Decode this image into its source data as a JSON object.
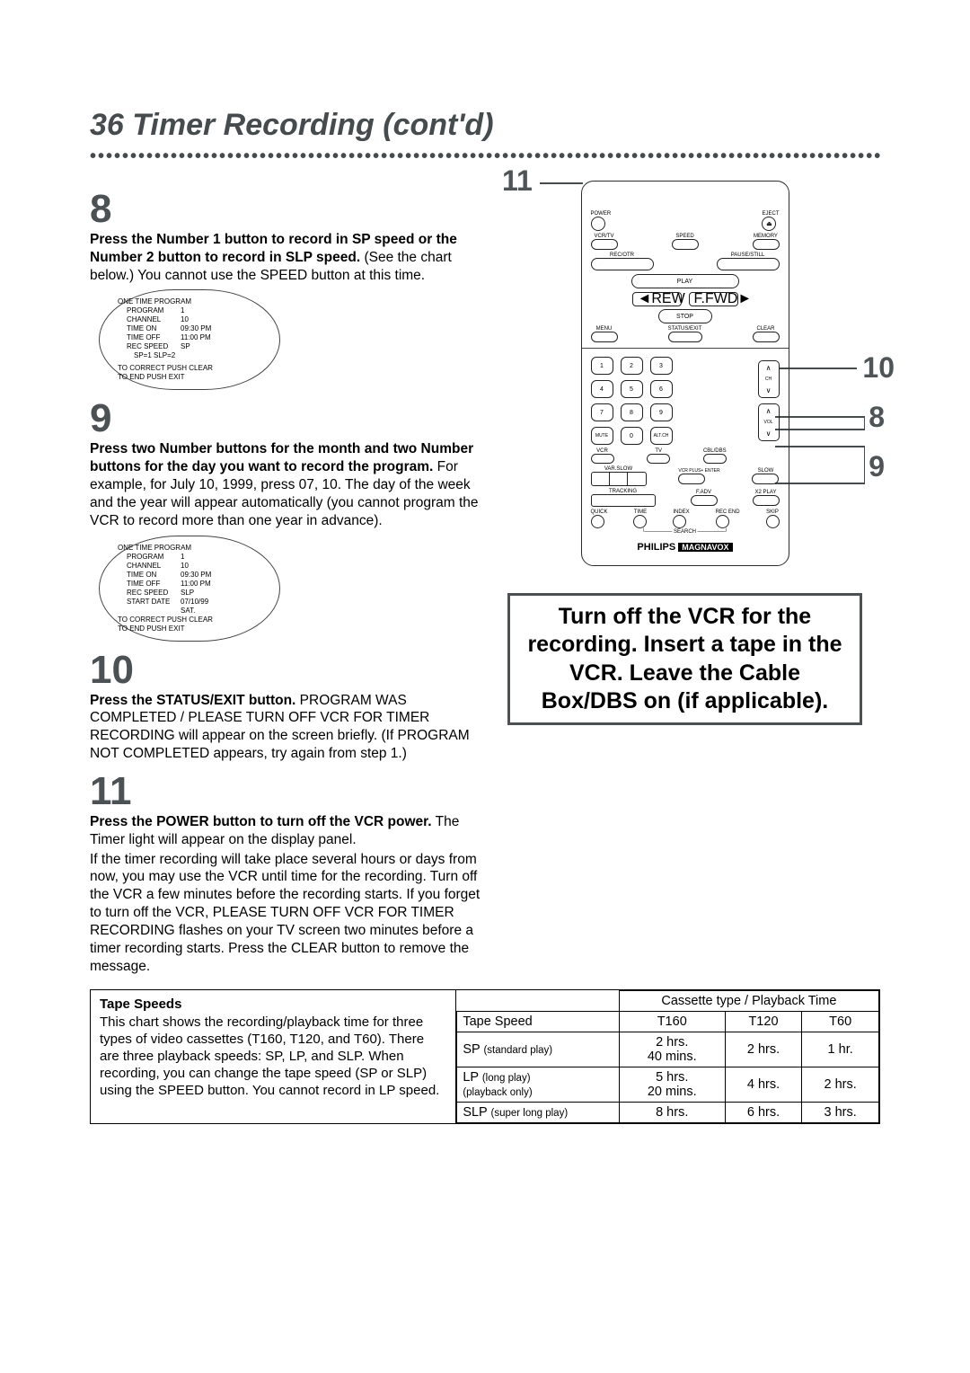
{
  "title": "36  Timer Recording (cont'd)",
  "steps": {
    "s8": {
      "num": "8",
      "bold": "Press the Number 1 button to record in SP speed or the Number 2 button to record in SLP speed.",
      "rest": " (See the chart below.) You cannot use the SPEED button at this time."
    },
    "s9": {
      "num": "9",
      "bold": "Press two Number buttons for the month and two Number buttons for the day you want to record the program.",
      "rest": " For example, for July 10, 1999, press 07, 10. The day of the week and the year will appear automatically (you cannot program the VCR to record more than one year in advance)."
    },
    "s10": {
      "num": "10",
      "bold": "Press the STATUS/EXIT button.",
      "rest": " PROGRAM WAS COMPLETED / PLEASE TURN OFF VCR FOR TIMER RECORDING will appear on the screen briefly. (If PROGRAM NOT COMPLETED appears, try again from step 1.)"
    },
    "s11": {
      "num": "11",
      "bold": "Press the POWER button to turn off the VCR power.",
      "rest": " The Timer light will appear on the display panel.",
      "para2": "If the timer recording will take place several hours or days from now, you may use the VCR until time for the recording. Turn off the VCR a few minutes before the recording starts. If you forget to turn off the VCR, PLEASE TURN OFF VCR FOR TIMER RECORDING flashes on your TV screen two minutes before a timer recording starts. Press the CLEAR button to remove the message."
    }
  },
  "osd1": {
    "title": "ONE TIME PROGRAM",
    "program": "1",
    "channel": "10",
    "timeon": "09:30 PM",
    "timeoff": "11:00 PM",
    "rec": "SP",
    "opts": "SP=1    SLP=2",
    "f1": "TO CORRECT PUSH CLEAR",
    "f2": "TO END PUSH EXIT"
  },
  "osd2": {
    "title": "ONE TIME PROGRAM",
    "program": "1",
    "channel": "10",
    "timeon": "09:30 PM",
    "timeoff": "11:00 PM",
    "rec": "SLP",
    "date": "07/10/99",
    "day": "SAT.",
    "f1": "TO CORRECT PUSH CLEAR",
    "f2": "TO END PUSH EXIT"
  },
  "osd_labels": {
    "program": "PROGRAM",
    "channel": "CHANNEL",
    "timeon": "TIME ON",
    "timeoff": "TIME OFF",
    "rec": "REC SPEED",
    "date": "START DATE"
  },
  "remote": {
    "power": "POWER",
    "eject": "EJECT",
    "vcrtv": "VCR/TV",
    "speed": "SPEED",
    "memory": "MEMORY",
    "recotr": "REC/OTR",
    "pause": "PAUSE/STILL",
    "play": "PLAY",
    "rew": "REW",
    "ffwd": "F.FWD",
    "stop": "STOP",
    "menu": "MENU",
    "status": "STATUS/EXIT",
    "clear": "CLEAR",
    "mute": "MUTE",
    "altch": "ALT.CH",
    "ch": "CH",
    "vol": "VOL",
    "vcr": "VCR",
    "tv": "TV",
    "cbl": "CBL/DBS",
    "varslow": "VAR.SLOW",
    "enter": "VCR PLUS+ ENTER",
    "slow": "SLOW",
    "tracking": "TRACKING",
    "fadv": "F.ADV",
    "x2": "X2 PLAY",
    "quick": "QUICK",
    "time": "TIME",
    "index": "INDEX",
    "recend": "REC END",
    "skip": "SKIP",
    "search": "SEARCH",
    "brand": "PHILIPS",
    "brand2": "MAGNAVOX"
  },
  "callouts": {
    "c11": "11",
    "c10": "10",
    "c8": "8",
    "c9": "9"
  },
  "sidebox": "Turn off the VCR for the recording. Insert a tape in the VCR. Leave the Cable Box/DBS on (if applicable).",
  "tape": {
    "heading": "Tape Speeds",
    "text": "This chart shows the recording/playback time for three types of video cassettes (T160, T120, and T60). There are three playback speeds: SP, LP, and SLP. When recording, you can change the tape speed (SP or SLP) using the SPEED button. You cannot record in LP speed.",
    "colhead": "Cassette type / Playback Time",
    "tsh": "Tape Speed",
    "t160": "T160",
    "t120": "T120",
    "t60": "T60",
    "sp": "SP",
    "sp_sub": "(standard play)",
    "sp160a": "2 hrs.",
    "sp160b": "40 mins.",
    "sp120": "2 hrs.",
    "sp60": "1 hr.",
    "lp": "LP",
    "lp_sub": "(long play)",
    "lp_sub2": "(playback only)",
    "lp160a": "5 hrs.",
    "lp160b": "20 mins.",
    "lp120": "4 hrs.",
    "lp60": "2 hrs.",
    "slp": "SLP",
    "slp_sub": "(super long play)",
    "slp160": "8 hrs.",
    "slp120": "6 hrs.",
    "slp60": "3 hrs."
  }
}
